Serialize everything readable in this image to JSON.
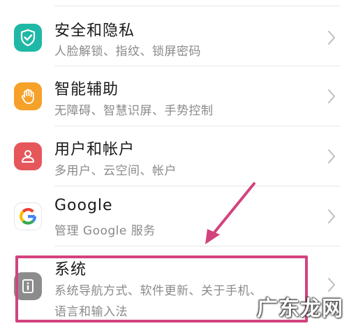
{
  "settings_items": [
    {
      "title": "安全和隐私",
      "subtitle": "人脸解锁、指纹、锁屏密码",
      "icon": "shield-check-icon",
      "color": "#1fb8a6"
    },
    {
      "title": "智能辅助",
      "subtitle": "无障碍、智慧识屏、手势控制",
      "icon": "hand-icon",
      "color": "#f5a12a"
    },
    {
      "title": "用户和帐户",
      "subtitle": "多用户、云空间、帐户",
      "icon": "user-icon",
      "color": "#e5575b"
    },
    {
      "title": "Google",
      "subtitle": "管理 Google 服务",
      "icon": "google-icon",
      "color": "#4285f4"
    },
    {
      "title": "系统",
      "subtitle_line1": "系统导航方式、软件更新、关于手机、",
      "subtitle_line2": "语言和输入法",
      "icon": "info-icon",
      "color": "#8c8c8c"
    }
  ],
  "annotation_color": "#d2437e",
  "watermark": "广东龙网"
}
